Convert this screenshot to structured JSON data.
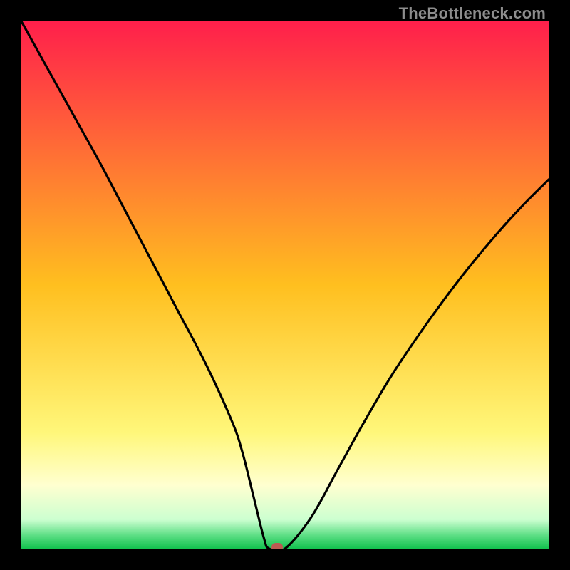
{
  "watermark": "TheBottleneck.com",
  "chart_data": {
    "type": "line",
    "title": "",
    "xlabel": "",
    "ylabel": "",
    "xlim": [
      0,
      100
    ],
    "ylim": [
      0,
      100
    ],
    "grid": false,
    "legend": false,
    "series": [
      {
        "name": "bottleneck-curve",
        "x": [
          0,
          5,
          10,
          15,
          20,
          25,
          30,
          35,
          40,
          42,
          44,
          46,
          47,
          50,
          55,
          60,
          65,
          70,
          75,
          80,
          85,
          90,
          95,
          100
        ],
        "y": [
          100,
          91,
          82,
          73,
          63.5,
          54,
          44.5,
          35,
          24,
          18,
          10,
          2,
          0,
          0,
          6,
          15,
          24,
          32.5,
          40,
          47,
          53.5,
          59.5,
          65,
          70
        ]
      }
    ],
    "marker": {
      "name": "bottleneck-point",
      "x": 48.5,
      "y": 0,
      "color": "#bb5a52"
    },
    "gradient_bg": {
      "stops": [
        {
          "offset": 0.0,
          "color": "#ff1f4b"
        },
        {
          "offset": 0.5,
          "color": "#ffbf1f"
        },
        {
          "offset": 0.78,
          "color": "#fff77a"
        },
        {
          "offset": 0.88,
          "color": "#ffffd0"
        },
        {
          "offset": 0.945,
          "color": "#ccffd0"
        },
        {
          "offset": 0.975,
          "color": "#5cde84"
        },
        {
          "offset": 1.0,
          "color": "#13c24f"
        }
      ]
    }
  }
}
